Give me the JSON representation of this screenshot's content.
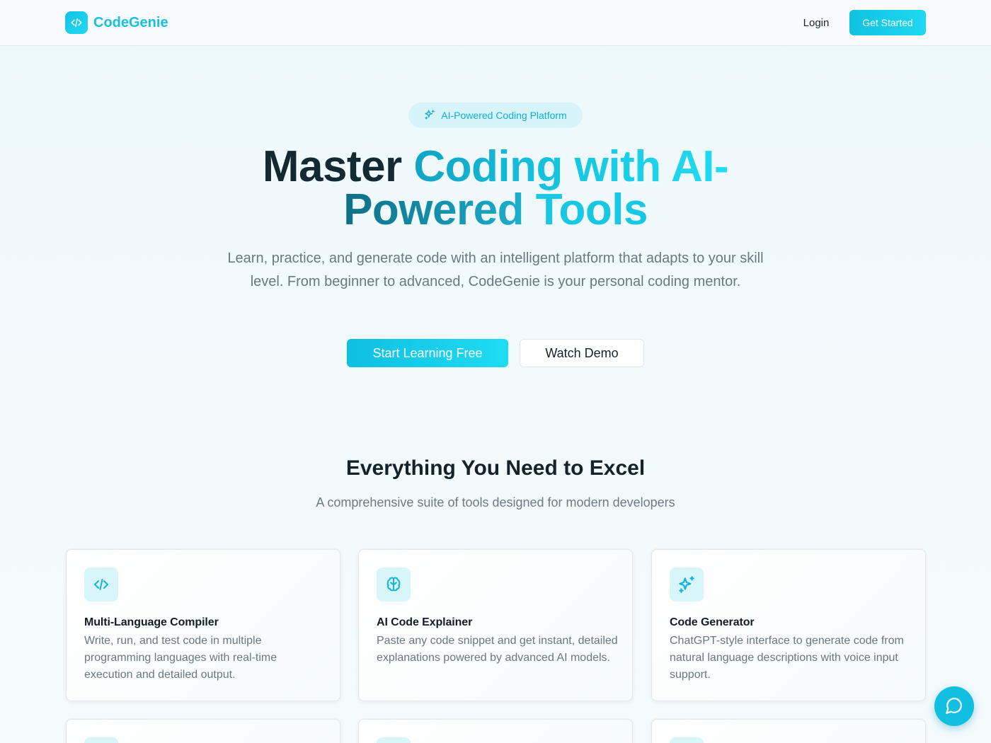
{
  "header": {
    "brand_name": "CodeGenie",
    "login_label": "Login",
    "get_started_label": "Get Started"
  },
  "hero": {
    "badge_label": "AI-Powered Coding Platform",
    "title_part1": "Master ",
    "title_part2": "Coding with AI-",
    "title_part3": "Powered ",
    "title_part4": "Tools",
    "subtitle": "Learn, practice, and generate code with an intelligent platform that adapts to your skill level. From beginner to advanced, CodeGenie is your personal coding mentor.",
    "primary_cta": "Start Learning Free",
    "secondary_cta": "Watch Demo"
  },
  "features": {
    "title": "Everything You Need to Excel",
    "subtitle": "A comprehensive suite of tools designed for modern developers",
    "cards": [
      {
        "icon": "code-icon",
        "title": "Multi-Language Compiler",
        "description": "Write, run, and test code in multiple programming languages with real-time execution and detailed output."
      },
      {
        "icon": "brain-icon",
        "title": "AI Code Explainer",
        "description": "Paste any code snippet and get instant, detailed explanations powered by advanced AI models."
      },
      {
        "icon": "sparkles-icon",
        "title": "Code Generator",
        "description": "ChatGPT-style interface to generate code from natural language descriptions with voice input support."
      }
    ]
  },
  "colors": {
    "accent": "#17c1e0",
    "dark_text": "#142a33",
    "muted_text": "#6b7880",
    "badge_bg": "#d6f4f9"
  }
}
